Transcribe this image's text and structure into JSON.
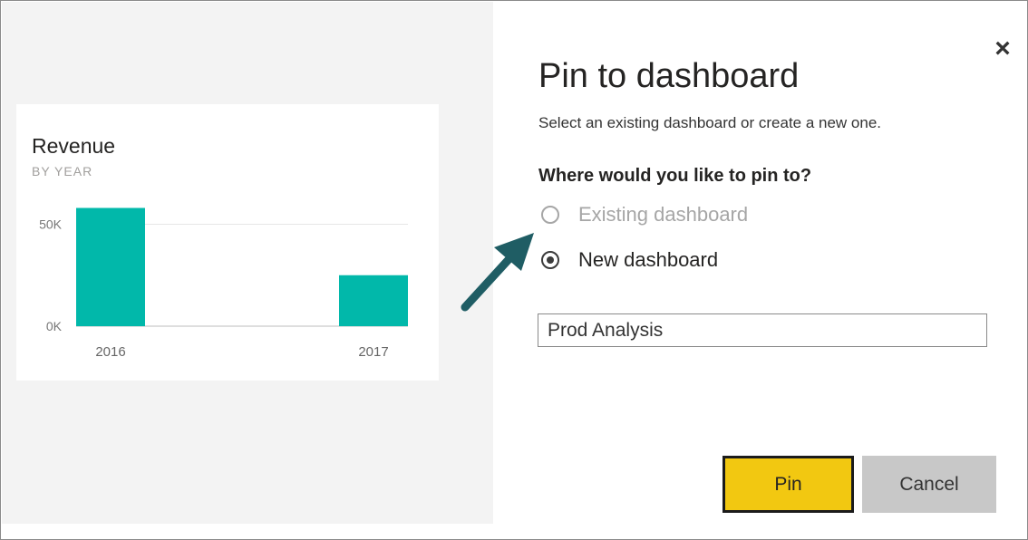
{
  "dialog": {
    "title": "Pin to dashboard",
    "subtitle": "Select an existing dashboard or create a new one.",
    "close_icon": "close-icon",
    "question": "Where would you like to pin to?",
    "options": [
      {
        "label": "Existing dashboard",
        "selected": false,
        "enabled": false
      },
      {
        "label": "New dashboard",
        "selected": true,
        "enabled": true
      }
    ],
    "dashboard_name_value": "Prod Analysis",
    "pin_label": "Pin",
    "cancel_label": "Cancel",
    "colors": {
      "pin_button": "#f2c811",
      "cancel_button": "#c8c8c8"
    }
  },
  "tile": {
    "title": "Revenue",
    "subtitle": "BY YEAR",
    "bar_color": "#01b8aa",
    "callout_arrow_color": "#1f5d64"
  },
  "chart_data": {
    "type": "bar",
    "title": "Revenue",
    "subtitle": "BY YEAR",
    "categories": [
      "2016",
      "2017"
    ],
    "values": [
      58000,
      25000
    ],
    "y_ticks": [
      0,
      50000
    ],
    "y_tick_labels": [
      "0K",
      "50K"
    ],
    "ylim": [
      0,
      60000
    ],
    "grid": true
  }
}
